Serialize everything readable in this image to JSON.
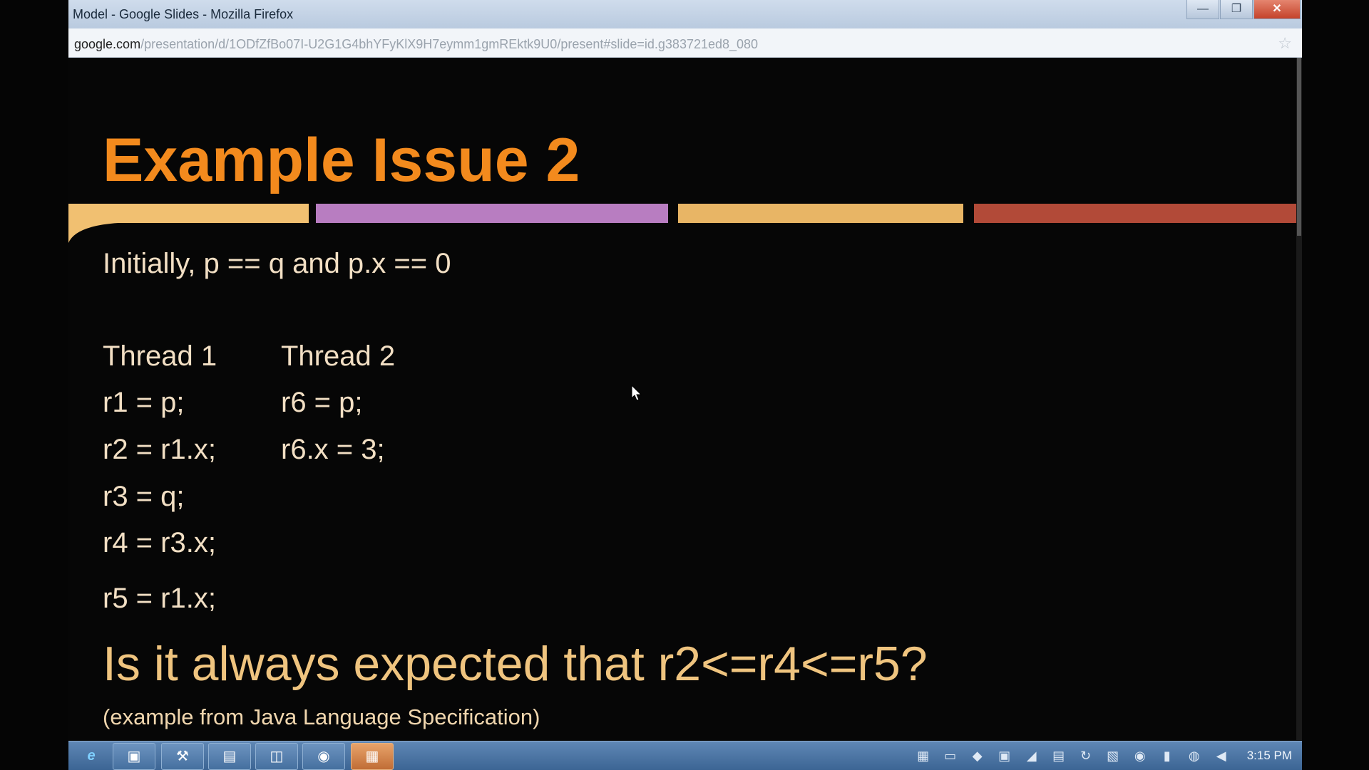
{
  "window": {
    "title": "Model - Google Slides - Mozilla Firefox",
    "controls": {
      "minimize": "—",
      "maximize": "❐",
      "close": "✕"
    }
  },
  "address_bar": {
    "domain": "google.com",
    "path": "/presentation/d/1ODfZfBo07I-U2G1G4bhYFyKlX9H7eymm1gmREktk9U0/present#slide=id.g383721ed8_080",
    "bookmark_icon": "star-icon"
  },
  "slide": {
    "title": "Example Issue 2",
    "band_colors": [
      "#f1c071",
      "#b87dc1",
      "#e8b565",
      "#b24a38"
    ],
    "initial_condition": "Initially, p == q and p.x == 0",
    "thread1": {
      "header": "Thread 1",
      "lines": [
        "r1 = p;",
        "r2 = r1.x;",
        "r3 = q;",
        "r4 = r3.x;",
        "r5 = r1.x;"
      ]
    },
    "thread2": {
      "header": "Thread 2",
      "lines": [
        "r6 = p;",
        "r6.x = 3;"
      ]
    },
    "question": "Is it always expected that r2<=r4<=r5?",
    "note": "(example from Java Language Specification)"
  },
  "taskbar": {
    "apps": [
      {
        "icon": "internet-explorer-icon",
        "glyph": "e"
      },
      {
        "icon": "explorer-icon",
        "glyph": "▣"
      },
      {
        "icon": "tools-icon",
        "glyph": "⚒"
      },
      {
        "icon": "folder-icon",
        "glyph": "▤"
      },
      {
        "icon": "remote-desktop-icon",
        "glyph": "◫"
      },
      {
        "icon": "firefox-icon",
        "glyph": "◉"
      },
      {
        "icon": "presentation-icon",
        "glyph": "▦"
      }
    ],
    "tray_icons": [
      "network-icon",
      "monitor-icon",
      "shield-icon",
      "chat-icon",
      "signal-icon",
      "disk-icon",
      "sync-icon",
      "notes-icon",
      "eye-icon",
      "battery-icon",
      "globe-icon",
      "volume-icon"
    ],
    "clock": "3:15 PM"
  }
}
